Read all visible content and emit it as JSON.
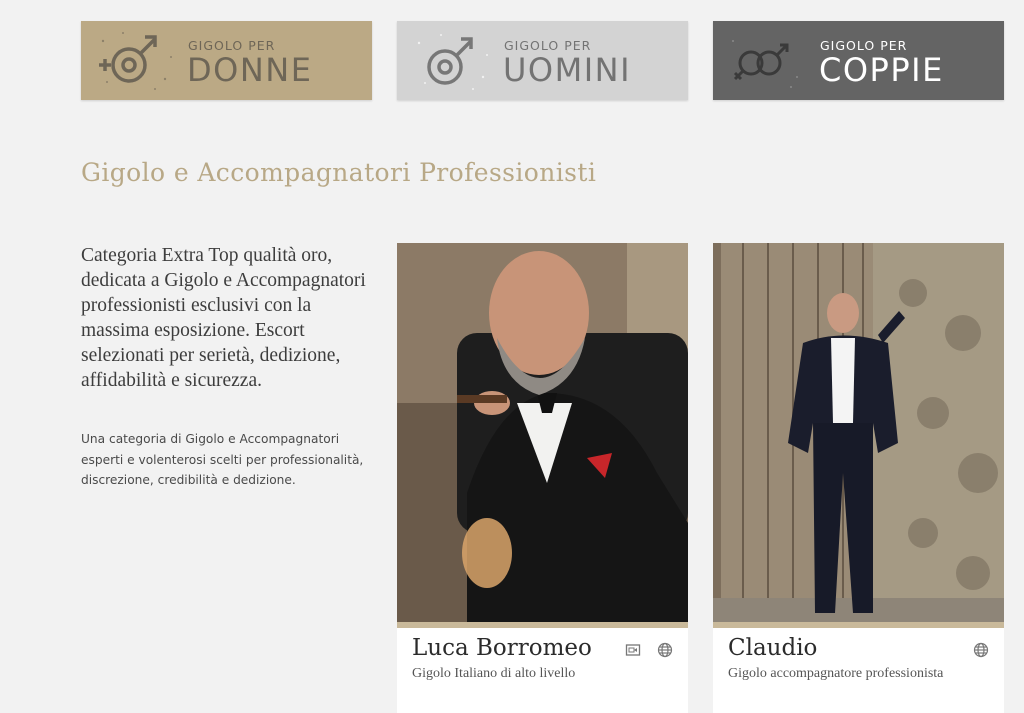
{
  "categories": [
    {
      "small": "GIGOLO PER",
      "big": "DONNE",
      "icon": "female-male-symbol-icon"
    },
    {
      "small": "GIGOLO PER",
      "big": "UOMINI",
      "icon": "male-symbol-icon"
    },
    {
      "small": "GIGOLO PER",
      "big": "COPPIE",
      "icon": "couple-symbol-icon"
    }
  ],
  "section": {
    "title": "Gigolo e Accompagnatori Professionisti",
    "intro": "Categoria Extra Top qualità oro, dedicata a Gigolo e Accompagnatori professionisti esclusivi con la massima esposizione. Escort selezionati per serietà, dedizione, affidabilità e sicurezza.",
    "intro_small": "Una categoria di Gigolo e Accompagnatori esperti e volenterosi scelti per professionalità, discrezione, credibilità e dedizione."
  },
  "profiles": [
    {
      "name": "Luca Borromeo",
      "subtitle": "Gigolo Italiano di alto livello",
      "icons": [
        "video-icon",
        "globe-icon"
      ]
    },
    {
      "name": "Claudio",
      "subtitle": "Gigolo accompagnatore professionista",
      "icons": [
        "globe-icon"
      ]
    }
  ],
  "colors": {
    "donne_bg": "#bba985",
    "uomini_bg": "#d3d3d3",
    "coppie_bg": "#646464",
    "title_gold": "#b8a886",
    "card_line": "#c9b99a"
  }
}
